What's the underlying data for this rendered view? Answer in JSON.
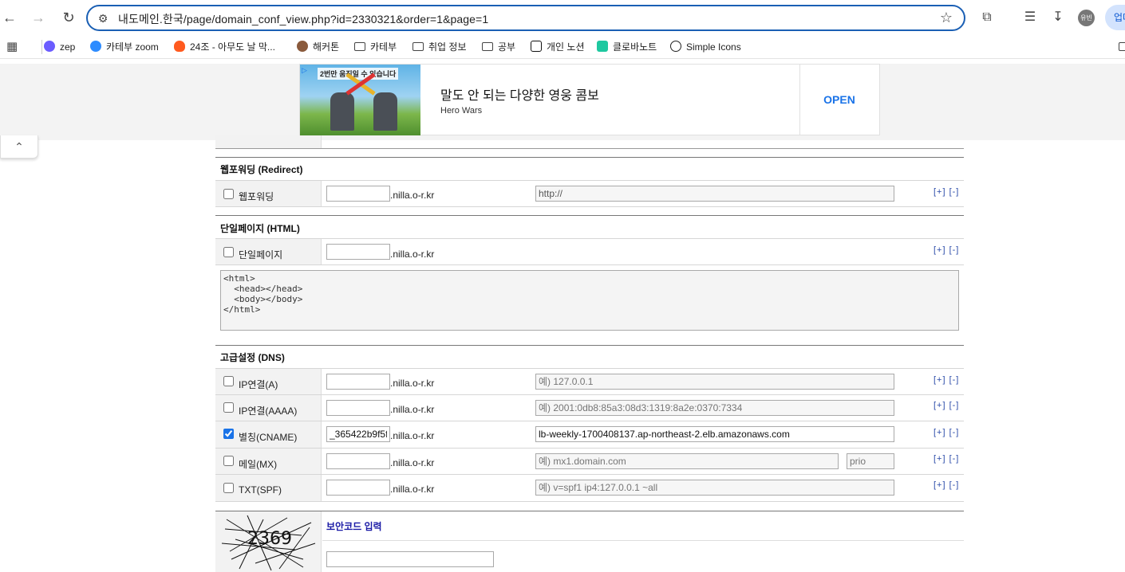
{
  "browser": {
    "url": "내도메인.한국/page/domain_conf_view.php?id=2330321&order=1&page=1",
    "avatar_text": "유빈",
    "update_label": "업데"
  },
  "bookmarks": [
    {
      "label": "zep",
      "color": "#6b5cff"
    },
    {
      "label": "카테부 zoom",
      "color": "#2d8cff"
    },
    {
      "label": "24조 - 아무도 날 막...",
      "color": "#ff5a1f"
    },
    {
      "label": "해커톤",
      "color": "#8a5a3c"
    },
    {
      "label": "카테부",
      "type": "folder"
    },
    {
      "label": "취업 정보",
      "type": "folder"
    },
    {
      "label": "공부",
      "type": "folder"
    },
    {
      "label": "개인 노션",
      "color": "#111111"
    },
    {
      "label": "클로바노트",
      "color": "#1ec8a0"
    },
    {
      "label": "Simple Icons",
      "color": "#222222"
    }
  ],
  "ad": {
    "image_caption": "2번만 움직일 수 있습니다",
    "headline": "말도 안 되는 다양한 영웅 콤보",
    "advertiser": "Hero Wars",
    "cta": "OPEN"
  },
  "form": {
    "domain_suffix": ".nilla.o-r.kr",
    "add_remove": "[+] [-]",
    "redirect": {
      "title": "웹포워딩 (Redirect)",
      "label": "웹포워딩",
      "url_value": "http://"
    },
    "html": {
      "title": "단일페이지 (HTML)",
      "label": "단일페이지",
      "code": "<html>\n  <head></head>\n  <body></body>\n</html>"
    },
    "dns": {
      "title": "고급설정 (DNS)",
      "rows": [
        {
          "label": "IP연결(A)",
          "checked": false,
          "host": "",
          "placeholder": "예) 127.0.0.1",
          "value": ""
        },
        {
          "label": "IP연결(AAAA)",
          "checked": false,
          "host": "",
          "placeholder": "예) 2001:0db8:85a3:08d3:1319:8a2e:0370:7334",
          "value": ""
        },
        {
          "label": "별칭(CNAME)",
          "checked": true,
          "host": "_365422b9f5f",
          "placeholder": "",
          "value": "lb-weekly-1700408137.ap-northeast-2.elb.amazonaws.com"
        },
        {
          "label": "메일(MX)",
          "checked": false,
          "host": "",
          "placeholder": "예) mx1.domain.com",
          "value": "",
          "prio_placeholder": "prio"
        },
        {
          "label": "TXT(SPF)",
          "checked": false,
          "host": "",
          "placeholder": "예) v=spf1 ip4:127.0.0.1 ~all",
          "value": ""
        }
      ]
    },
    "security": {
      "label": "보안코드 입력",
      "captcha_text": "2369"
    }
  }
}
